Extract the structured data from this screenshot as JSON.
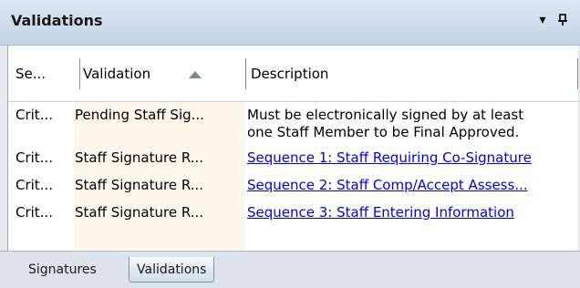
{
  "panel": {
    "title": "Validations",
    "menu_glyph": "▾",
    "pin_glyph": "ᴨ"
  },
  "grid": {
    "columns": [
      {
        "label": "Se..."
      },
      {
        "label": "Validation",
        "sort": "ascending"
      },
      {
        "label": "Description"
      }
    ],
    "rows": [
      {
        "severity": "Crit...",
        "validation": "Pending Staff Sig...",
        "description_lines": [
          "Must be electronically signed by at least",
          "one Staff Member to be Final Approved."
        ],
        "is_link": false
      },
      {
        "severity": "Crit...",
        "validation": "Staff Signature R...",
        "description": "Sequence 1: Staff Requiring Co-Signature",
        "is_link": true
      },
      {
        "severity": "Crit...",
        "validation": "Staff Signature R...",
        "description": "Sequence 2: Staff Comp/Accept Assess...",
        "is_link": true
      },
      {
        "severity": "Crit...",
        "validation": "Staff Signature R...",
        "description": "Sequence 3: Staff Entering Information",
        "is_link": true
      }
    ]
  },
  "tabs": [
    {
      "label": "Signatures",
      "active": false
    },
    {
      "label": "Validations",
      "active": true
    }
  ],
  "colors": {
    "link": "#0000ee",
    "validation_column_bg": "#fdf7ec",
    "titlebar": "#c5d4e6"
  }
}
